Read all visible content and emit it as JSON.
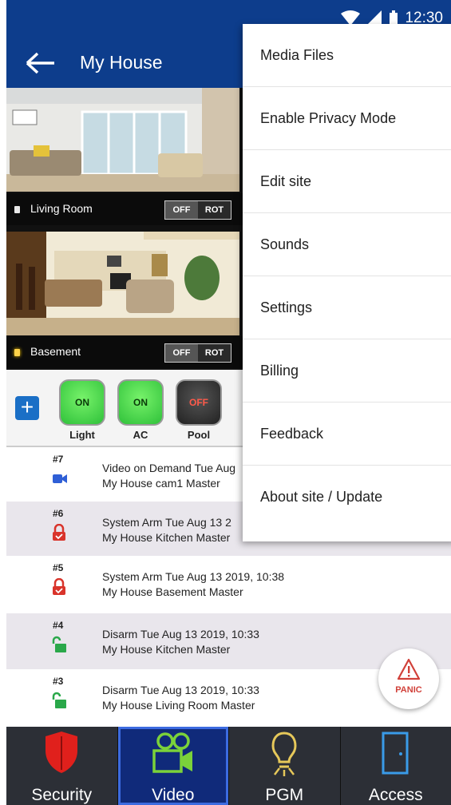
{
  "status_bar": {
    "time": "12:30"
  },
  "app_bar": {
    "title": "My House"
  },
  "cameras": [
    {
      "label": "Living Room",
      "off": "OFF",
      "rot": "ROT"
    },
    {
      "label": "Basement",
      "off": "OFF",
      "rot": "ROT"
    }
  ],
  "devices": [
    {
      "name": "Light",
      "state": "ON"
    },
    {
      "name": "AC",
      "state": "ON"
    },
    {
      "name": "Pool",
      "state": "OFF"
    }
  ],
  "events": [
    {
      "num": "#7",
      "line1": "Video on Demand Tue Aug",
      "line2": "My House cam1 Master",
      "icon": "video-camera-icon"
    },
    {
      "num": "#6",
      "line1": "System Arm Tue Aug 13 2",
      "line2": "My House Kitchen Master",
      "icon": "lock-closed-icon"
    },
    {
      "num": "#5",
      "line1": "System Arm Tue Aug 13 2019, 10:38",
      "line2": "My House Basement Master",
      "icon": "lock-closed-icon"
    },
    {
      "num": "#4",
      "line1": "Disarm Tue Aug 13 2019, 10:33",
      "line2": "My House Kitchen Master",
      "icon": "lock-open-icon"
    },
    {
      "num": "#3",
      "line1": "Disarm Tue Aug 13 2019, 10:33",
      "line2": "My House Living Room Master",
      "icon": "lock-open-icon"
    }
  ],
  "panic": {
    "label": "PANIC"
  },
  "bottom_nav": [
    {
      "label": "Security",
      "icon": "shield-icon"
    },
    {
      "label": "Video",
      "icon": "video-camera-icon",
      "active": true
    },
    {
      "label": "PGM",
      "icon": "lightbulb-icon"
    },
    {
      "label": "Access",
      "icon": "door-icon"
    }
  ],
  "menu": {
    "items": [
      "Media Files",
      "Enable Privacy Mode",
      "Edit site",
      "Sounds",
      "Settings",
      "Billing",
      "Feedback",
      "About site / Update"
    ]
  },
  "colors": {
    "primary": "#0d3d8c",
    "on_green": "#2fc13a",
    "lock_red": "#d9342b",
    "lock_green": "#2aa84a",
    "active_tab": "#102a7a"
  }
}
